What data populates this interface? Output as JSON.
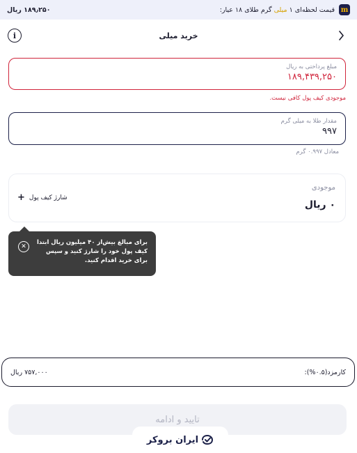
{
  "top_bar": {
    "price_prefix": "قیمت لحظه‌ای ۱",
    "price_highlight": "میلی",
    "price_suffix": "گرم طلای ۱۸ عیار:",
    "price_value": "۱۸۹٫۲۵۰ ریال",
    "logo_letter": "m"
  },
  "header": {
    "title": "خرید میلی"
  },
  "payment_field": {
    "label": "مبلغ پرداختی به ریال",
    "value": "۱۸۹,۴۳۹,۲۵۰",
    "error": "موجودی کیف پول کافی نیست."
  },
  "gold_field": {
    "label": "مقدار طلا به میلی گرم",
    "value": "۹۹۷",
    "equivalent": "معادل ۰.۹۹۷ گرم"
  },
  "balance": {
    "label": "موجودی",
    "value": "۰ ریال",
    "charge_label": "شارژ کیف پول"
  },
  "tooltip": {
    "text": "برای مبالغ بیش‌از ۴۰ میلیون ریال ابتدا کیف پول خود را شارژ کنید و سپس برای خرید اقدام کنید."
  },
  "fee": {
    "label": "کارمزد(۰.۵%):",
    "value": "۷۵۷,۰۰۰ ریال"
  },
  "confirm": {
    "label": "تایید و ادامه"
  },
  "brand": {
    "name": "ایران بروکر"
  },
  "colors": {
    "error": "#d0243b",
    "dark": "#1c2149",
    "accent": "#d6a100"
  }
}
